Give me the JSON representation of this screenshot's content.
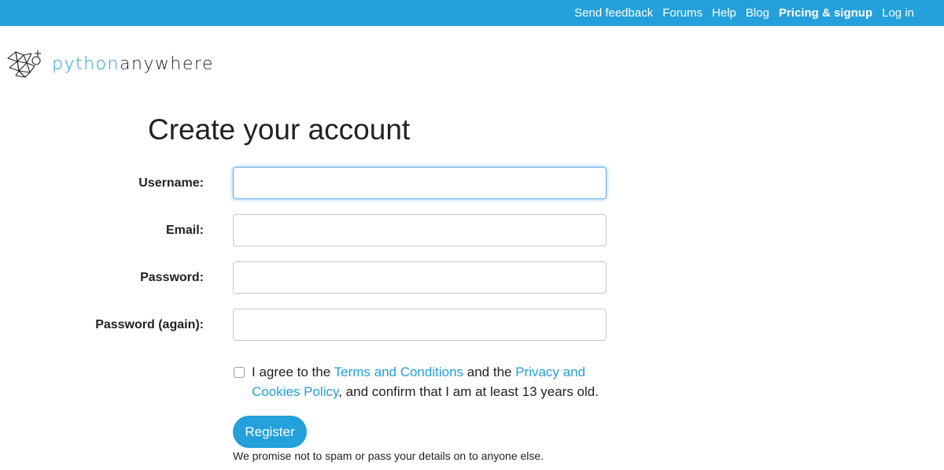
{
  "nav": {
    "items": [
      {
        "label": "Send feedback",
        "bold": false
      },
      {
        "label": "Forums",
        "bold": false
      },
      {
        "label": "Help",
        "bold": false
      },
      {
        "label": "Blog",
        "bold": false
      },
      {
        "label": "Pricing & signup",
        "bold": true
      },
      {
        "label": "Log in",
        "bold": false
      }
    ]
  },
  "logo": {
    "part1": "python",
    "part2": "anywhere",
    "icon": "pythonanywhere-logo-icon"
  },
  "page": {
    "title": "Create your account"
  },
  "form": {
    "username": {
      "label": "Username:",
      "value": "",
      "placeholder": ""
    },
    "email": {
      "label": "Email:",
      "value": "",
      "placeholder": ""
    },
    "password": {
      "label": "Password:",
      "value": "",
      "placeholder": ""
    },
    "password_again": {
      "label": "Password (again):",
      "value": "",
      "placeholder": ""
    },
    "agree": {
      "checked": false,
      "text1": "I agree to the ",
      "terms_link": "Terms and Conditions",
      "text2": " and the ",
      "privacy_link": "Privacy and Cookies Policy",
      "text3": ", and confirm that I am at least 13 years old."
    },
    "register_label": "Register",
    "promise": "We promise not to spam or pass your details on to anyone else."
  },
  "colors": {
    "accent": "#24a0da",
    "focus": "#66afe9",
    "text": "#222222"
  }
}
